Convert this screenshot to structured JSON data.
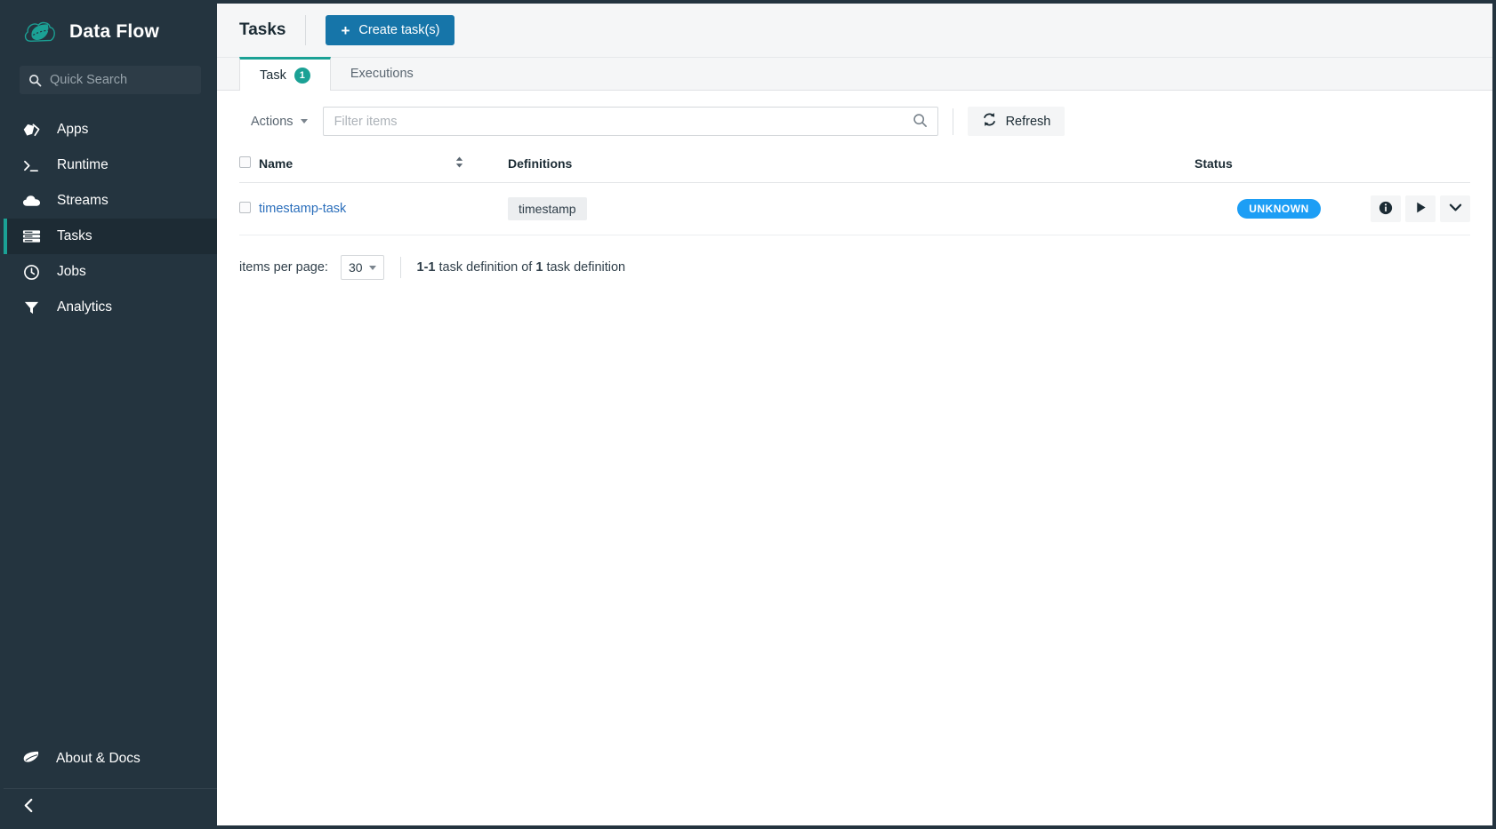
{
  "sidebar": {
    "brand": {
      "title": "Data Flow",
      "logo_icon": "spring-leaf-cloud-logo"
    },
    "quick_search": {
      "placeholder": "Quick Search",
      "icon": "search-icon"
    },
    "items": [
      {
        "label": "Apps",
        "icon": "tag-icon"
      },
      {
        "label": "Runtime",
        "icon": "terminal-prompt-icon"
      },
      {
        "label": "Streams",
        "icon": "cloud-icon"
      },
      {
        "label": "Tasks",
        "icon": "server-stack-icon"
      },
      {
        "label": "Jobs",
        "icon": "clock-icon"
      },
      {
        "label": "Analytics",
        "icon": "funnel-icon"
      }
    ],
    "active_item": "Tasks",
    "about": {
      "label": "About & Docs",
      "icon": "leaf-icon"
    },
    "collapse": {
      "icon": "chevron-left-icon"
    },
    "colors": {
      "background": "#24343f",
      "active_background": "#1d2b34",
      "accent": "#1ba195"
    }
  },
  "header": {
    "title": "Tasks",
    "create_button": {
      "label": "Create task(s)",
      "icon": "plus-icon",
      "color": "#1675a9"
    }
  },
  "tabs": [
    {
      "label": "Task",
      "badge": "1",
      "active": true
    },
    {
      "label": "Executions",
      "badge": null,
      "active": false
    }
  ],
  "toolbar": {
    "actions_label": "Actions",
    "filter": {
      "value": "",
      "placeholder": "Filter items",
      "icon": "search-icon"
    },
    "refresh": {
      "label": "Refresh",
      "icon": "refresh-icon"
    }
  },
  "table": {
    "columns": [
      {
        "key": "name",
        "label": "Name",
        "sortable": true,
        "sort_icon": "sort-updown-icon"
      },
      {
        "key": "definitions",
        "label": "Definitions"
      },
      {
        "key": "status",
        "label": "Status"
      }
    ],
    "rows": [
      {
        "name": "timestamp-task",
        "definition": "timestamp",
        "status": "UNKNOWN",
        "status_color": "#1d9ef5",
        "actions": [
          {
            "name": "details",
            "icon": "info-icon"
          },
          {
            "name": "launch",
            "icon": "play-icon"
          },
          {
            "name": "more",
            "icon": "chevron-down-icon"
          }
        ]
      }
    ]
  },
  "pagination": {
    "items_per_page_label": "items per page:",
    "items_per_page_value": "30",
    "summary_range": "1-1",
    "summary_mid": " task definition of ",
    "summary_total": "1",
    "summary_suffix": " task definition"
  }
}
